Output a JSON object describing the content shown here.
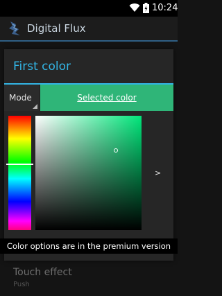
{
  "status_bar": {
    "time": "10:24",
    "icons": [
      "wifi-icon",
      "battery-icon"
    ]
  },
  "action_bar": {
    "title": "Digital Flux",
    "icon": "app-icon"
  },
  "background_settings": {
    "item_title": "Touch effect",
    "item_summary": "Push"
  },
  "dialog": {
    "title": "First color",
    "mode_label": "Mode",
    "selected_color_label": "Selected color",
    "selected_color_hex": "#2fb578",
    "next_arrow": ">"
  },
  "toast": {
    "message": "Color options are in the premium version"
  },
  "colors": {
    "accent": "#33b5e5",
    "selected": "#2fb578"
  }
}
